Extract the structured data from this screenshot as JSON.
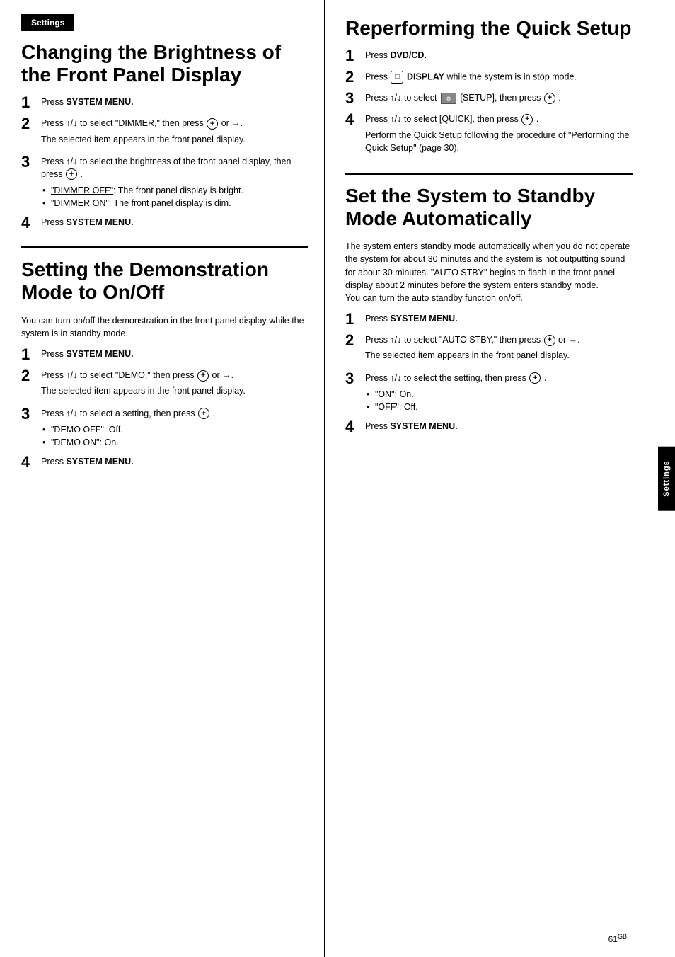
{
  "settings_tab": "Settings",
  "vertical_settings_tab": "Settings",
  "page_number": "61",
  "page_number_suffix": "GB",
  "left_col": {
    "section1": {
      "title": "Changing the Brightness of the Front Panel Display",
      "steps": [
        {
          "num": "1",
          "html_content": "Press <strong>SYSTEM MENU.</strong>"
        },
        {
          "num": "2",
          "html_content": "Press ↑/↓ to select \"DIMMER,\" then press <span class='circle-icon'>+</span> or →.",
          "sub_text": "The selected item appears in the front panel display."
        },
        {
          "num": "3",
          "html_content": "Press ↑/↓ to select the brightness of the front panel display, then press <span class='circle-icon'>+</span> .",
          "bullets": [
            "\"DIMMER OFF\": The front panel display is bright.",
            "\"DIMMER ON\": The front panel display is dim."
          ]
        },
        {
          "num": "4",
          "html_content": "Press <strong>SYSTEM MENU.</strong>"
        }
      ]
    },
    "section2": {
      "title": "Setting the Demonstration Mode to On/Off",
      "intro": "You can turn on/off the demonstration in the front panel display while the system is in standby mode.",
      "steps": [
        {
          "num": "1",
          "html_content": "Press <strong>SYSTEM MENU.</strong>"
        },
        {
          "num": "2",
          "html_content": "Press ↑/↓ to select \"DEMO,\" then press <span class='circle-icon'>+</span> or →.",
          "sub_text": "The selected item appears in the front panel display."
        },
        {
          "num": "3",
          "html_content": "Press ↑/↓ to select a setting, then press <span class='circle-icon'>+</span> .",
          "bullets": [
            "\"DEMO OFF\": Off.",
            "\"DEMO ON\": On."
          ]
        },
        {
          "num": "4",
          "html_content": "Press <strong>SYSTEM MENU.</strong>"
        }
      ]
    }
  },
  "right_col": {
    "section1": {
      "title": "Reperforming the Quick Setup",
      "steps": [
        {
          "num": "1",
          "html_content": "Press <strong>DVD/CD.</strong>"
        },
        {
          "num": "2",
          "html_content": "Press <span class='display-btn-icon'>□</span> <strong>DISPLAY</strong> while the system is in stop mode."
        },
        {
          "num": "3",
          "html_content": "Press ↑/↓ to select <span class='setup-icon'>SETUP</span> [SETUP], then press <span class='circle-icon'>+</span> ."
        },
        {
          "num": "4",
          "html_content": "Press ↑/↓ to select [QUICK], then press <span class='circle-icon'>+</span> .",
          "sub_text": "Perform the Quick Setup following the procedure of \"Performing the Quick Setup\" (page 30)."
        }
      ]
    },
    "section2": {
      "title": "Set the System to Standby Mode Automatically",
      "intro": "The system enters standby mode automatically when you do not operate the system for about 30 minutes and the system is not outputting sound for about 30 minutes. \"AUTO STBY\" begins to flash in the front panel display about 2 minutes before the system enters standby mode.\nYou can turn the auto standby function on/off.",
      "steps": [
        {
          "num": "1",
          "html_content": "Press <strong>SYSTEM MENU.</strong>"
        },
        {
          "num": "2",
          "html_content": "Press ↑/↓ to select \"AUTO STBY,\" then press <span class='circle-icon'>+</span> or →.",
          "sub_text": "The selected item appears in the front panel display."
        },
        {
          "num": "3",
          "html_content": "Press ↑/↓ to select the setting, then press <span class='circle-icon'>+</span> .",
          "bullets": [
            "\"ON\": On.",
            "\"OFF\": Off."
          ]
        },
        {
          "num": "4",
          "html_content": "Press <strong>SYSTEM MENU.</strong>"
        }
      ]
    }
  }
}
